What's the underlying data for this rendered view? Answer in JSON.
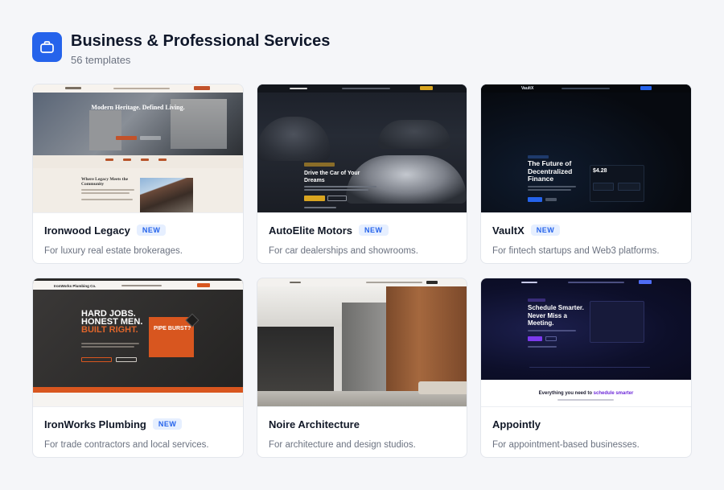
{
  "category": {
    "title": "Business & Professional Services",
    "count": "56 templates",
    "icon": "briefcase-icon",
    "accent": "#2563eb"
  },
  "cards": [
    {
      "name": "Ironwood Legacy",
      "badge": "NEW",
      "description": "For luxury real estate brokerages.",
      "preview": {
        "headline": "Modern Heritage. Defined Living.",
        "subheadline": "Where Legacy Meets the Community"
      }
    },
    {
      "name": "AutoElite Motors",
      "badge": "NEW",
      "description": "For car dealerships and showrooms.",
      "preview": {
        "headline": "Drive the Car of Your Dreams"
      }
    },
    {
      "name": "VaultX",
      "badge": "NEW",
      "description": "For fintech startups and Web3 platforms.",
      "preview": {
        "brand": "VaultX",
        "headline": "The Future of Decentralized Finance",
        "price": "$4.28"
      }
    },
    {
      "name": "IronWorks Plumbing",
      "badge": "NEW",
      "description": "For trade contractors and local services.",
      "preview": {
        "brand": "IronWorks Plumbing Co.",
        "headline_l1": "HARD JOBS.",
        "headline_l2": "HONEST MEN.",
        "headline_l3": "BUILT RIGHT.",
        "callout": "PIPE BURST?"
      }
    },
    {
      "name": "Noire Architecture",
      "badge": "",
      "description": "For architecture and design studios."
    },
    {
      "name": "Appointly",
      "badge": "",
      "description": "For appointment-based businesses.",
      "preview": {
        "headline": "Schedule Smarter. Never Miss a Meeting.",
        "sub_lead": "Everything you need to ",
        "sub_accent": "schedule smarter"
      }
    }
  ]
}
